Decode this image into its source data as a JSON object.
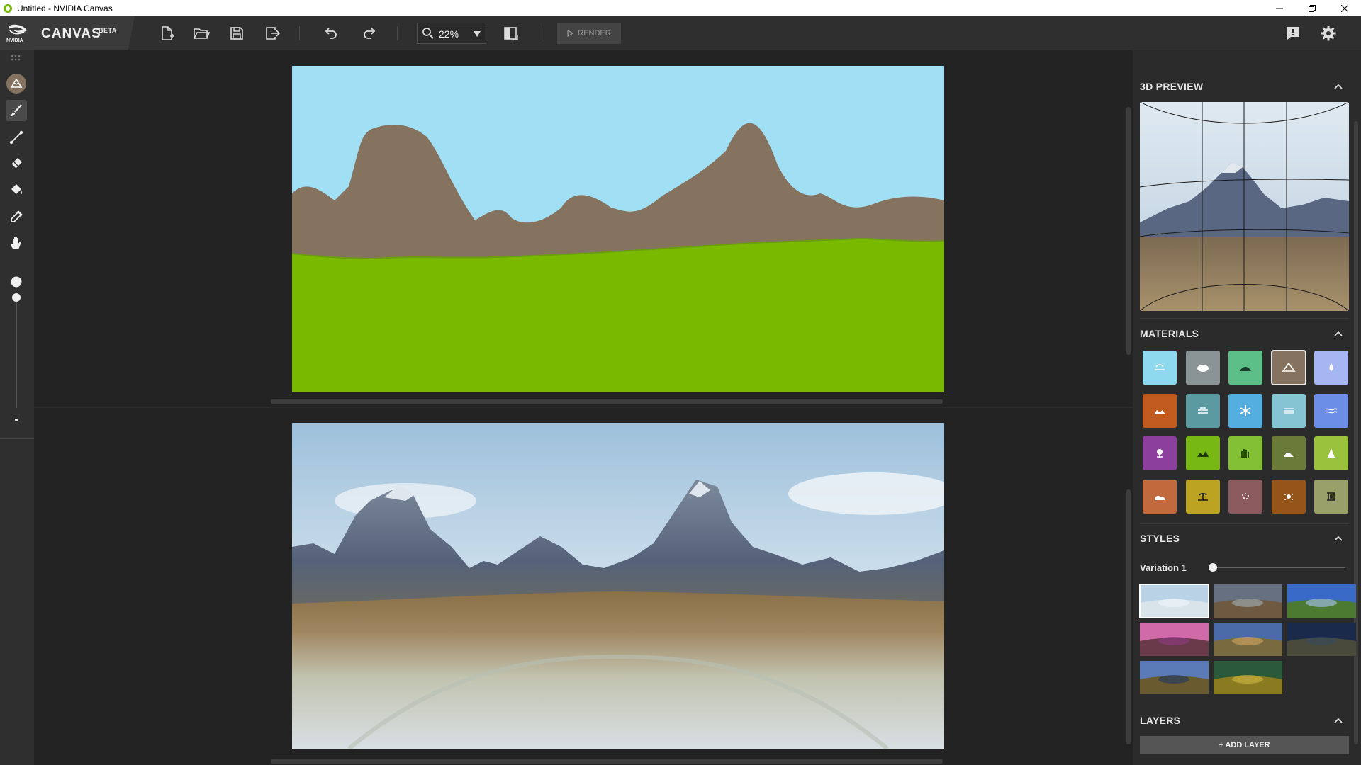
{
  "window": {
    "title": "Untitled - NVIDIA Canvas"
  },
  "toolbar": {
    "brand_logo_text": "NVIDIA",
    "app_name": "CANVAS",
    "beta": "BETA",
    "zoom_value": "22%",
    "render_label": "RENDER",
    "icons": [
      "new-file-icon",
      "open-folder-icon",
      "save-icon",
      "export-icon",
      "undo-icon",
      "redo-icon",
      "zoom-icon",
      "zoom-dropdown-icon",
      "toggle-view-icon",
      "feedback-icon",
      "settings-icon"
    ]
  },
  "left_tools": [
    "material-icon",
    "brush-icon",
    "line-icon",
    "eraser-icon",
    "fill-bucket-icon",
    "eyedropper-icon",
    "pan-hand-icon"
  ],
  "right_panel": {
    "preview_title": "3D PREVIEW",
    "materials_title": "MATERIALS",
    "styles_title": "STYLES",
    "variation_label": "Variation 1",
    "variation_value": 0,
    "layers_title": "LAYERS",
    "add_layer_label": "+ ADD LAYER",
    "materials": [
      {
        "name": "sky",
        "color": "#8fd9ef"
      },
      {
        "name": "cloud",
        "color": "#8a9396"
      },
      {
        "name": "hill",
        "color": "#5bbf87"
      },
      {
        "name": "mountain",
        "color": "#85735f"
      },
      {
        "name": "water-drop",
        "color": "#a6b6f2"
      },
      {
        "name": "dirt",
        "color": "#c05a1e"
      },
      {
        "name": "fog",
        "color": "#5b9aa0"
      },
      {
        "name": "snow",
        "color": "#55aee0"
      },
      {
        "name": "sea",
        "color": "#86c4d4"
      },
      {
        "name": "river",
        "color": "#6c8ee6"
      },
      {
        "name": "flower",
        "color": "#8d3f9d"
      },
      {
        "name": "grass",
        "color": "#78b814"
      },
      {
        "name": "tall-grass",
        "color": "#84c035"
      },
      {
        "name": "rock",
        "color": "#6a7a38"
      },
      {
        "name": "tree",
        "color": "#9ac23c"
      },
      {
        "name": "stone",
        "color": "#c06a3e"
      },
      {
        "name": "beach",
        "color": "#bca322"
      },
      {
        "name": "gravel",
        "color": "#8a5a5f"
      },
      {
        "name": "sand",
        "color": "#94541a"
      },
      {
        "name": "building",
        "color": "#9aa06a"
      }
    ],
    "selected_material": "mountain",
    "selected_style": 0
  },
  "colors": {
    "sky": "#a1e0f4",
    "mountain": "#85735f",
    "grass": "#79ba00"
  }
}
